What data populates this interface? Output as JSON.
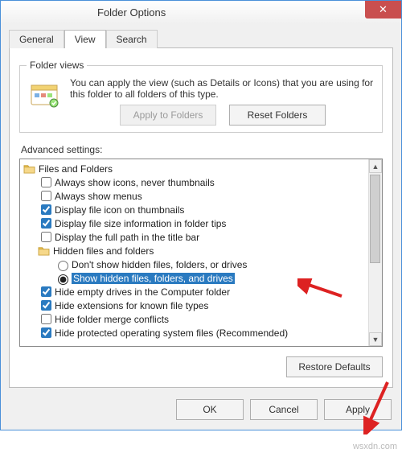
{
  "window": {
    "title": "Folder Options",
    "close_tooltip": "Close"
  },
  "tabs": {
    "general": "General",
    "view": "View",
    "search": "Search",
    "active_index": 1
  },
  "folder_views": {
    "legend": "Folder views",
    "description": "You can apply the view (such as Details or Icons) that you are using for this folder to all folders of this type.",
    "apply_button": "Apply to Folders",
    "reset_button": "Reset Folders",
    "apply_enabled": false
  },
  "advanced": {
    "label": "Advanced settings:",
    "root_label": "Files and Folders",
    "items": [
      {
        "type": "checkbox",
        "checked": false,
        "label": "Always show icons, never thumbnails"
      },
      {
        "type": "checkbox",
        "checked": false,
        "label": "Always show menus"
      },
      {
        "type": "checkbox",
        "checked": true,
        "label": "Display file icon on thumbnails"
      },
      {
        "type": "checkbox",
        "checked": true,
        "label": "Display file size information in folder tips"
      },
      {
        "type": "checkbox",
        "checked": false,
        "label": "Display the full path in the title bar"
      },
      {
        "type": "group",
        "label": "Hidden files and folders"
      },
      {
        "type": "radio",
        "checked": false,
        "label": "Don't show hidden files, folders, or drives",
        "indent": 2
      },
      {
        "type": "radio",
        "checked": true,
        "label": "Show hidden files, folders, and drives",
        "indent": 2,
        "selected": true
      },
      {
        "type": "checkbox",
        "checked": true,
        "label": "Hide empty drives in the Computer folder"
      },
      {
        "type": "checkbox",
        "checked": true,
        "label": "Hide extensions for known file types"
      },
      {
        "type": "checkbox",
        "checked": false,
        "label": "Hide folder merge conflicts"
      },
      {
        "type": "checkbox",
        "checked": true,
        "label": "Hide protected operating system files (Recommended)"
      }
    ]
  },
  "buttons": {
    "restore_defaults": "Restore Defaults",
    "ok": "OK",
    "cancel": "Cancel",
    "apply": "Apply"
  },
  "watermark": "wsxdn.com"
}
